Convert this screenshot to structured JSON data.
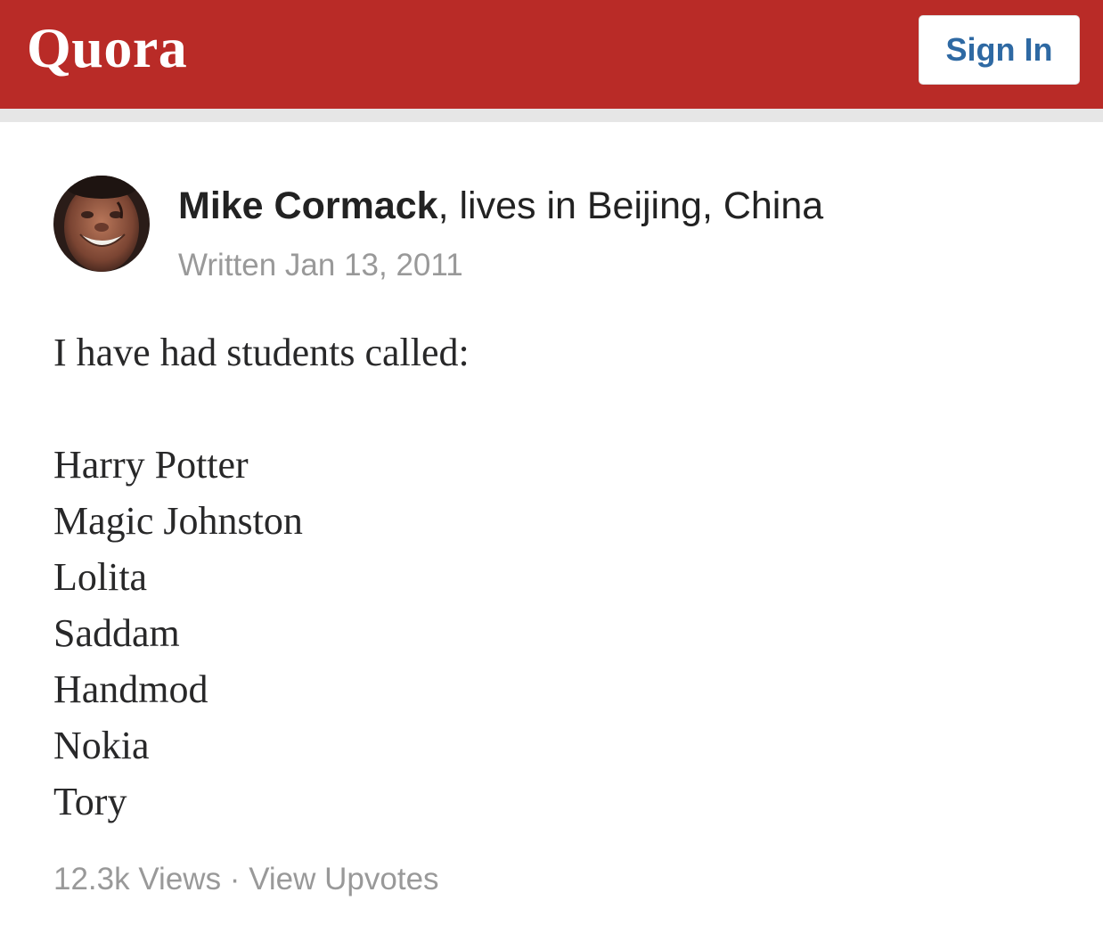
{
  "header": {
    "logo_text": "Quora",
    "signin_label": "Sign In",
    "brand_color": "#b92b27",
    "signin_text_color": "#2e69a3"
  },
  "answer": {
    "author": {
      "name": "Mike Cormack",
      "credential": ", lives in Beijing, China",
      "avatar_icon": "user-avatar-photo"
    },
    "written": "Written Jan 13, 2011",
    "intro": "I have had students called:",
    "names": [
      "Harry Potter",
      "Magic Johnston",
      "Lolita",
      "Saddam",
      "Handmod",
      "Nokia",
      "Tory"
    ],
    "views": "12.3k Views",
    "separator": " · ",
    "upvotes_link": "View Upvotes"
  }
}
